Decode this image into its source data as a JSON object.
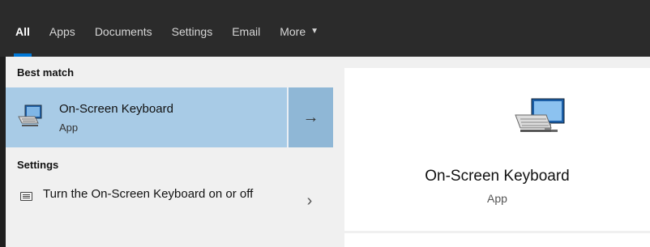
{
  "tabs": [
    {
      "label": "All"
    },
    {
      "label": "Apps"
    },
    {
      "label": "Documents"
    },
    {
      "label": "Settings"
    },
    {
      "label": "Email"
    },
    {
      "label": "More"
    }
  ],
  "results": {
    "best_match_header": "Best match",
    "best_match": {
      "title": "On-Screen Keyboard",
      "subtitle": "App",
      "icon": "keyboard-monitor-icon",
      "arrow_icon": "arrow-right-icon"
    },
    "settings_header": "Settings",
    "settings_item": {
      "label": "Turn the On-Screen Keyboard on or off",
      "icon": "keyboard-icon",
      "chevron_icon": "chevron-right-icon"
    }
  },
  "preview": {
    "title": "On-Screen Keyboard",
    "subtitle": "App",
    "icon": "keyboard-monitor-icon"
  },
  "colors": {
    "tabbar_bg": "#2b2b2b",
    "active_underline": "#0078d7",
    "selected_bg": "#a8cbe6",
    "pane_bg": "#f0f0f0"
  }
}
